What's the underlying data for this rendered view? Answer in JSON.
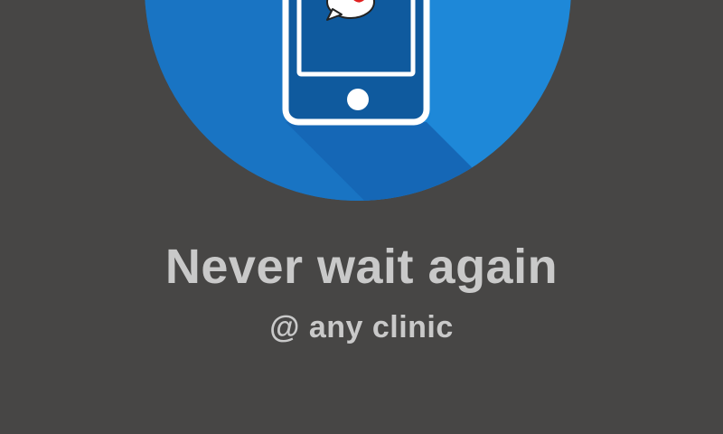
{
  "onboarding": {
    "headline": "Never wait again",
    "subheadline": "@ any clinic"
  },
  "icons": {
    "illustration": "phone-notification-icon",
    "bubble": "chat-bubble-icon"
  },
  "colors": {
    "background": "#474645",
    "circle": "#1e88d8",
    "circle_shadow": "#1565b4",
    "phone_screen": "#0f5a9e",
    "phone_outline": "#ffffff",
    "text": "#c9c9c9",
    "accent_red": "#e02020"
  }
}
